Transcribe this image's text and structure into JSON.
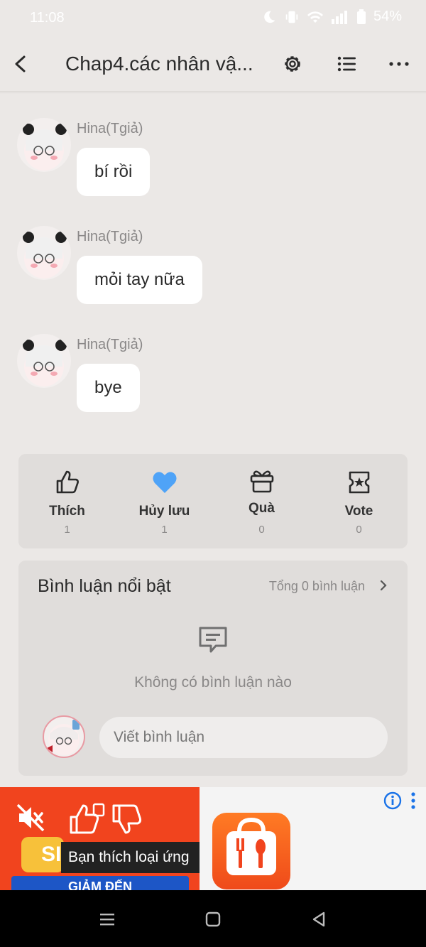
{
  "status": {
    "time": "11:08",
    "battery": "54%"
  },
  "header": {
    "title": "Chap4.các nhân vậ..."
  },
  "messages": [
    {
      "author": "Hina(Tgiả)",
      "text": "bí rồi"
    },
    {
      "author": "Hina(Tgiả)",
      "text": "mỏi tay nữa"
    },
    {
      "author": "Hina(Tgiả)",
      "text": "bye"
    }
  ],
  "actions": [
    {
      "label": "Thích",
      "count": "1",
      "icon": "thumbs-up-icon"
    },
    {
      "label": "Hủy lưu",
      "count": "1",
      "icon": "heart-icon"
    },
    {
      "label": "Quà",
      "count": "0",
      "icon": "gift-icon"
    },
    {
      "label": "Vote",
      "count": "0",
      "icon": "vote-icon"
    }
  ],
  "comments": {
    "title": "Bình luận nổi bật",
    "total": "Tổng 0 bình luận",
    "empty": "Không có bình luận nào",
    "placeholder": "Viết bình luận"
  },
  "ad": {
    "tooltip": "Bạn thích loại ứng",
    "banner": "GIẢM ĐẾN",
    "sale_text": "SI"
  },
  "colors": {
    "accent": "#4fa3f7",
    "background": "#ebe8e6",
    "card": "#e0dddb",
    "ad_red": "#f1441e"
  }
}
